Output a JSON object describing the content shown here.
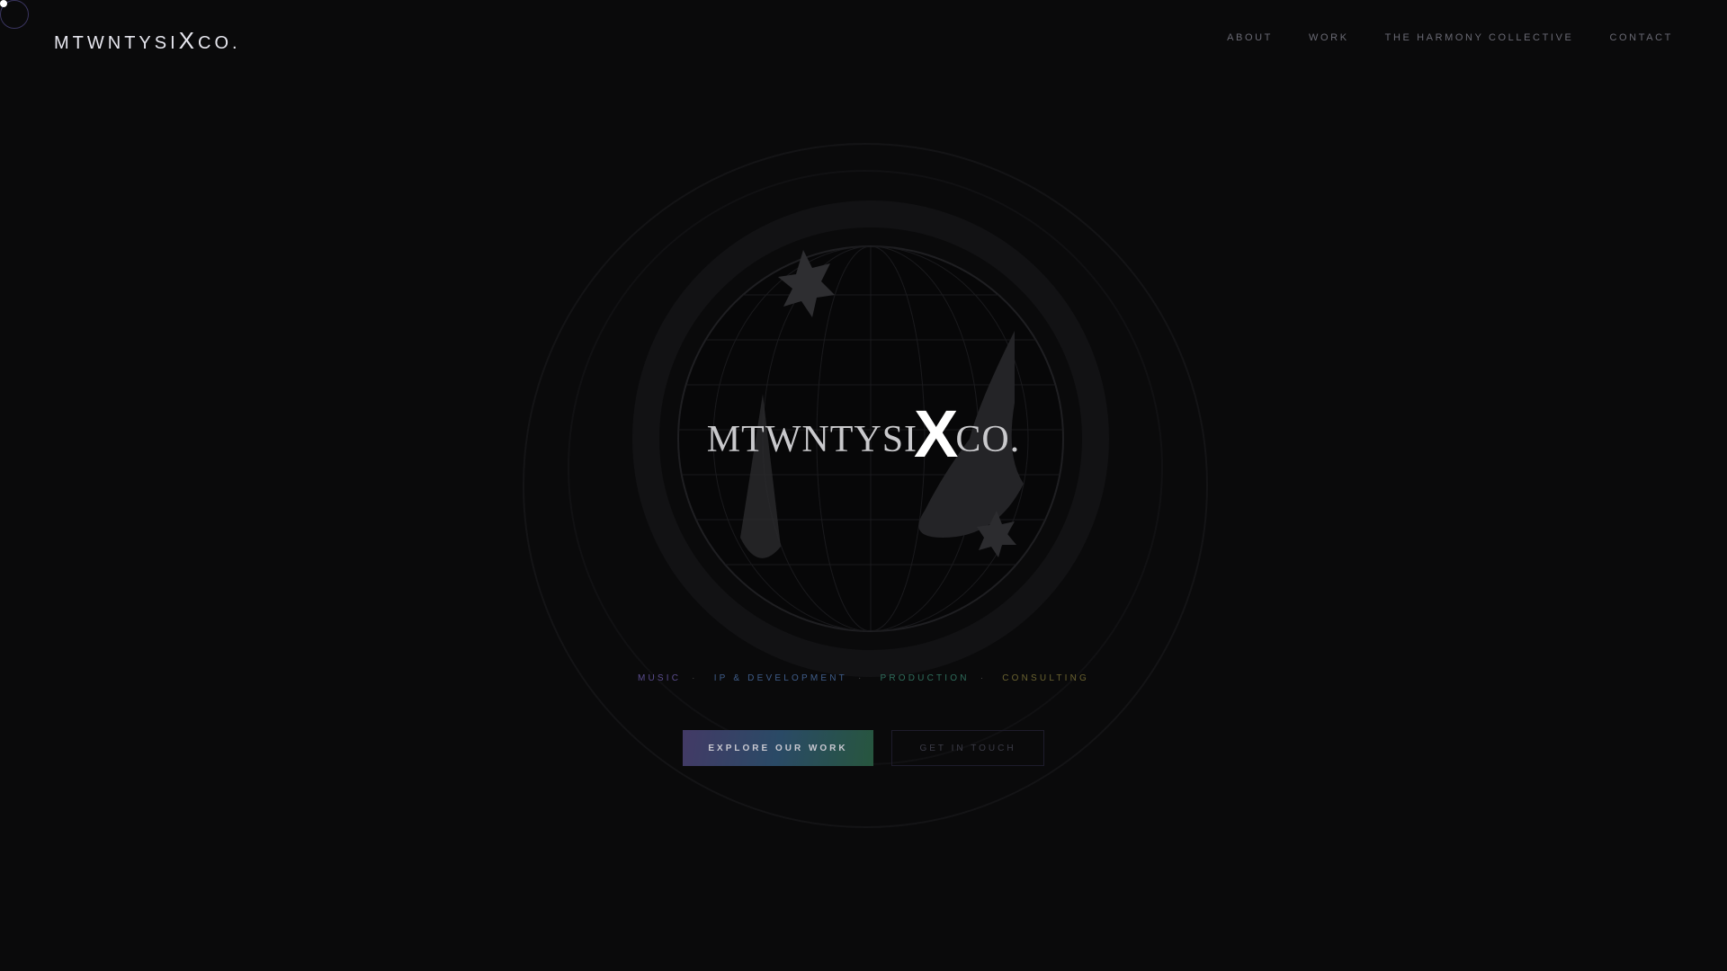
{
  "brand": {
    "prefix": "MTWNTYSI",
    "x": "X",
    "suffix": "CO."
  },
  "nav": [
    {
      "label": "ABOUT"
    },
    {
      "label": "WORK"
    },
    {
      "label": "THE HARMONY COLLECTIVE"
    },
    {
      "label": "CONTACT"
    }
  ],
  "hero": {
    "logo": {
      "prefix": "MTWNTYSI",
      "x": "X",
      "suffix": "CO."
    },
    "tagline": [
      {
        "label": "MUSIC",
        "color": "#5b4d8f"
      },
      {
        "label": "IP & DEVELOPMENT",
        "color": "#3f5d8a"
      },
      {
        "label": "PRODUCTION",
        "color": "#2f6e5c"
      },
      {
        "label": "CONSULTING",
        "color": "#6b6330"
      }
    ],
    "separator": "·",
    "primary_button": "EXPLORE OUR WORK",
    "secondary_button": "GET IN TOUCH"
  }
}
